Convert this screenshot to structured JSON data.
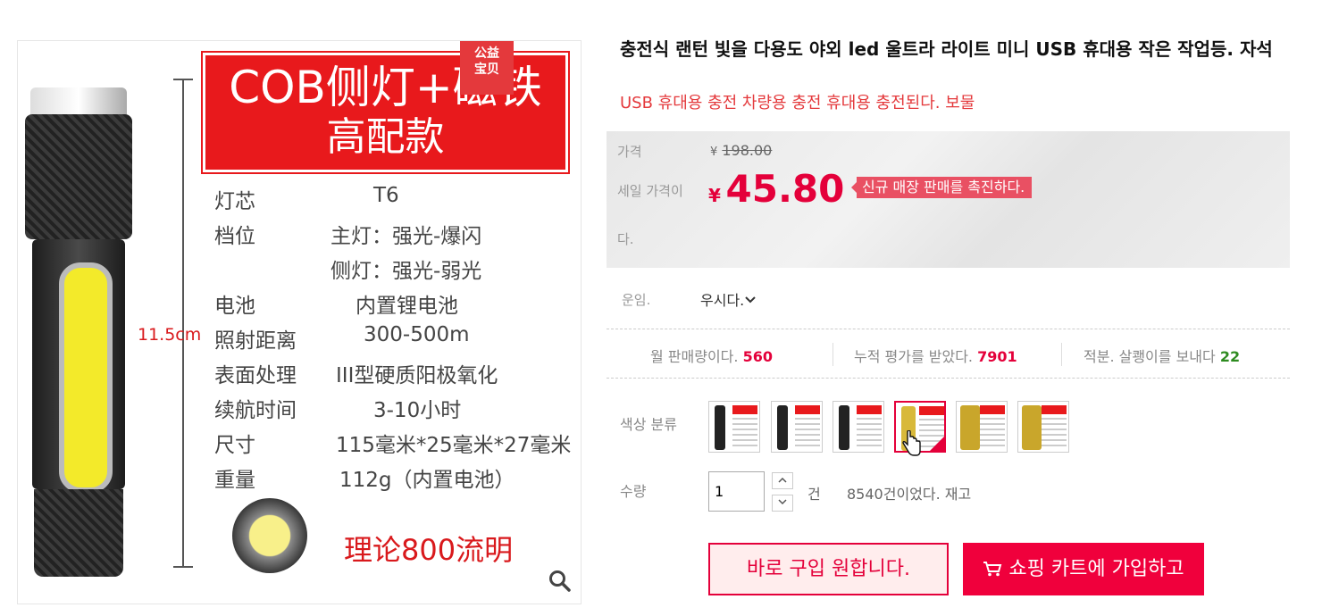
{
  "gallery": {
    "badge": [
      "公益",
      "宝贝"
    ],
    "banner": {
      "line1": "COB侧灯+磁铁",
      "line2": "高配款"
    },
    "specs": [
      {
        "k": "灯芯",
        "v": "T6"
      },
      {
        "k": "档位",
        "v": "主灯：强光-爆闪"
      },
      {
        "k": "",
        "v": "侧灯：强光-弱光"
      },
      {
        "k": "电池",
        "v": "内置锂电池"
      },
      {
        "k": "照射距离",
        "v": "300-500m"
      },
      {
        "k": "表面处理",
        "v": "III型硬质阳极氧化"
      },
      {
        "k": "续航时间",
        "v": "3-10小时"
      },
      {
        "k": "尺寸",
        "v": "115毫米*25毫米*27毫米"
      },
      {
        "k": "重量",
        "v": "112g（内置电池）"
      }
    ],
    "length": "11.5cm",
    "lumen": "理论800流明",
    "zoom_icon": "magnifier-icon"
  },
  "product": {
    "title": "충전식 랜턴 빛을 다용도 야외 led 울트라 라이트 미니 USB 휴대용 작은 작업등. 자석",
    "subtitle": "USB 휴대용 충전 차량용 충전 휴대용 충전된다. 보물"
  },
  "price": {
    "orig_label": "가격",
    "currency": "¥",
    "orig_value": "198.00",
    "sale_label_1": "세일 가격이",
    "sale_label_2": "다.",
    "sale_value": "45.80",
    "promo": "신규 매장 판매를 촉진하다."
  },
  "shipping": {
    "label": "운임.",
    "value": "우시다."
  },
  "stats": {
    "monthly_label": "월 판매량이다.",
    "monthly_value": "560",
    "reviews_label": "누적 평가를 받았다.",
    "reviews_value": "7901",
    "points_label": "적분. 살쾡이를 보내다",
    "points_value": "22"
  },
  "colors": {
    "label": "색상 분류",
    "selected_index": 3,
    "count": 6
  },
  "quantity": {
    "label": "수량",
    "value": "1",
    "unit": "건",
    "stock": "8540건이었다. 재고"
  },
  "actions": {
    "buy": "바로 구입 원합니다.",
    "cart": "쇼핑 카트에 가입하고"
  },
  "accent_color": "#e4003a"
}
